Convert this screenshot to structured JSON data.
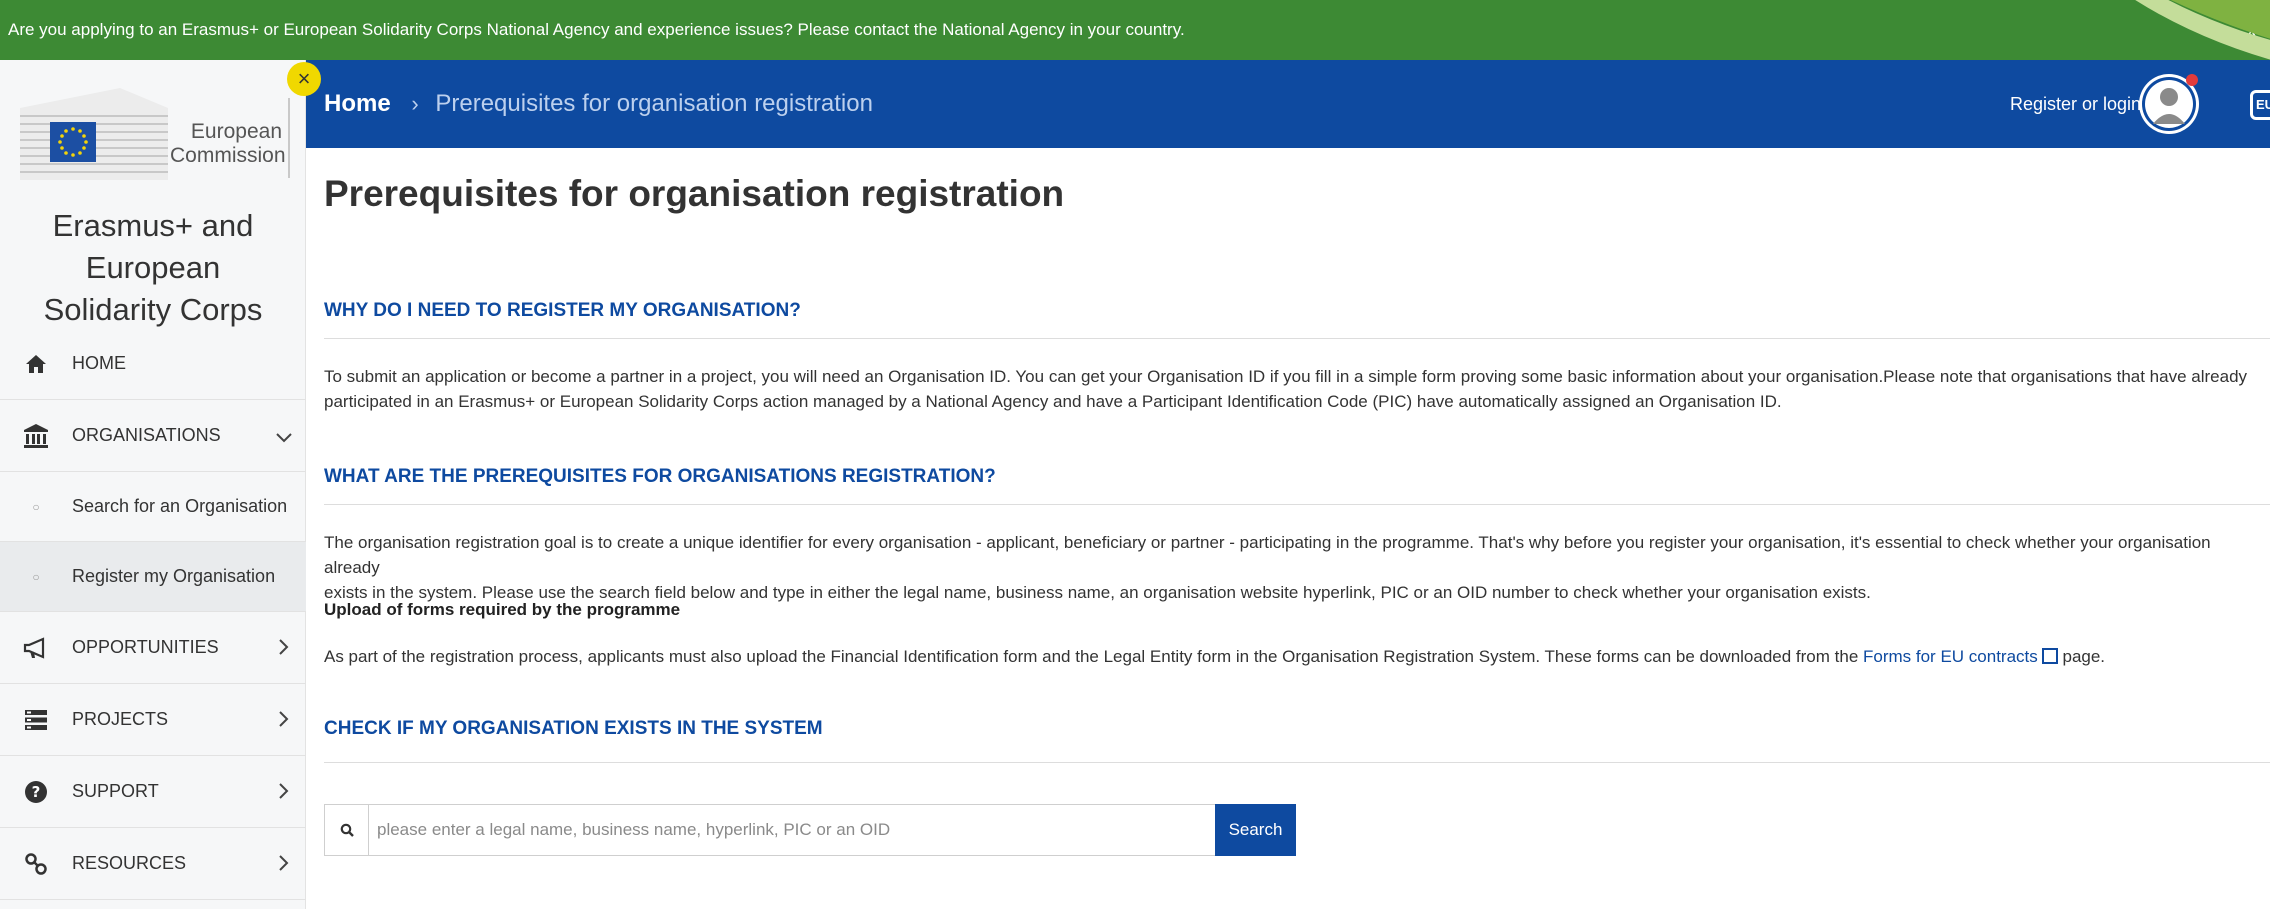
{
  "notice": {
    "text": "Are you applying to an Erasmus+ or European Solidarity Corps National Agency and experience issues? Please contact the National Agency in your country.",
    "close": "x"
  },
  "logo": {
    "line1": "European",
    "line2": "Commission"
  },
  "sidebar": {
    "close_badge": "×",
    "app_title_line1": "Erasmus+ and European",
    "app_title_line2": "Solidarity Corps",
    "items": [
      {
        "label": "HOME",
        "icon": "home-icon"
      },
      {
        "label": "ORGANISATIONS",
        "icon": "institution-icon",
        "chevron": "⌄"
      },
      {
        "label": "Search for an Organisation",
        "sub": true
      },
      {
        "label": "Register my Organisation",
        "sub": true,
        "active": true
      },
      {
        "label": "OPPORTUNITIES",
        "icon": "megaphone-icon",
        "chevron": "›"
      },
      {
        "label": "PROJECTS",
        "icon": "projects-icon",
        "chevron": "›"
      },
      {
        "label": "SUPPORT",
        "icon": "help-icon",
        "chevron": "›"
      },
      {
        "label": "RESOURCES",
        "icon": "resources-icon",
        "chevron": "›"
      }
    ]
  },
  "header": {
    "breadcrumb_home": "Home",
    "breadcrumb_sep": "›",
    "breadcrumb_current": "Prerequisites for organisation registration",
    "login": "Register or login",
    "chat_label": "EU"
  },
  "main": {
    "title": "Prerequisites for organisation registration",
    "s1_head": "WHY DO I NEED TO REGISTER MY ORGANISATION?",
    "s1_p1_line1": "To submit an application or become a partner in a project, you will need an Organisation ID. You can get your Organisation ID if you fill in a simple form proving some basic information about your organisation.Please note that organisations that have already",
    "s1_p1_line2": "participated in an Erasmus+ or European Solidarity Corps action managed by a National Agency and have a Participant Identification Code (PIC) have automatically assigned an Organisation ID.",
    "s2_head": "WHAT ARE THE PREREQUISITES FOR ORGANISATIONS REGISTRATION?",
    "s2_p1_line1": "The organisation registration goal is to create a unique identifier for every organisation - applicant, beneficiary or partner - participating in the programme. That's why before you register your organisation, it's essential to check whether your organisation already",
    "s2_p1_line2": "exists in the system. Please use the search field below and type in either the legal name, business name, an organisation website hyperlink, PIC or an OID number to check whether your organisation exists.",
    "s2_sub": "Upload of forms required by the programme",
    "s2_p2_pre": "As part of the registration process, applicants must also upload the Financial Identification form and the Legal Entity form in the Organisation Registration System. These forms can be downloaded from the ",
    "s2_p2_link": "Forms for EU contracts",
    "s2_p2_post": " page.",
    "s3_head": "CHECK IF MY ORGANISATION EXISTS IN THE SYSTEM",
    "search_placeholder": "please enter a legal name, business name, hyperlink, PIC or an OID",
    "search_button": "Search"
  },
  "colors": {
    "notice_green": "#3d8a34",
    "brand_blue": "#0e4aa0",
    "badge_yellow": "#f0d800"
  }
}
